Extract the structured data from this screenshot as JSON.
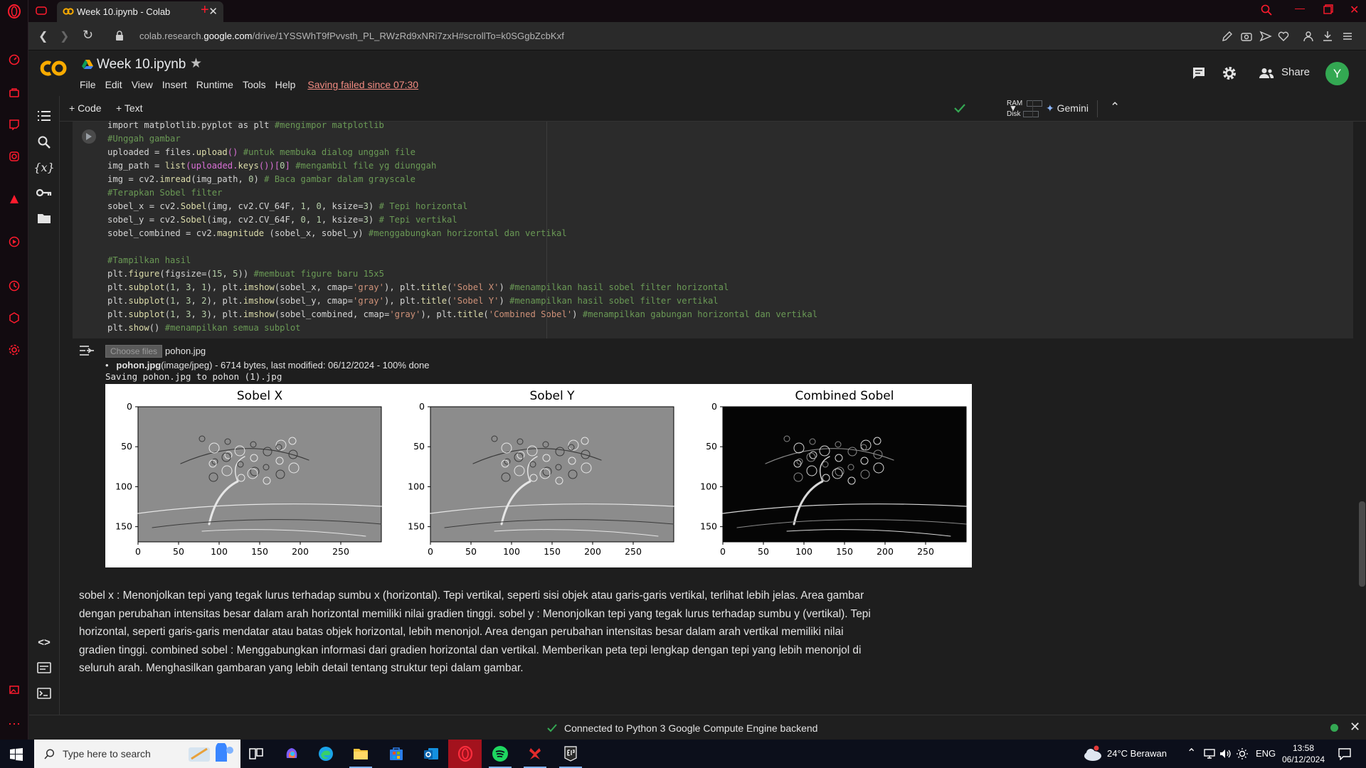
{
  "browser": {
    "tab_title": "Week 10.ipynb - Colab",
    "url_prefix": "colab.research.",
    "url_domain": "google.com",
    "url_path": "/drive/1YSSWhT9fPvvsth_PL_RWzRd9xNRi7zxH#scrollTo=k0SGgbZcbKxf"
  },
  "colab": {
    "notebook_title": "Week 10.ipynb",
    "menu": [
      "File",
      "Edit",
      "View",
      "Insert",
      "Runtime",
      "Tools",
      "Help"
    ],
    "saving_status": "Saving failed since 07:30",
    "share_label": "Share",
    "avatar_letter": "Y",
    "add_code": "+ Code",
    "add_text": "+ Text",
    "ram_label": "RAM",
    "disk_label": "Disk",
    "gemini_label": "Gemini"
  },
  "code_lines": [
    [
      [
        "import matplotlib.pyplot as plt ",
        ""
      ],
      [
        "#mengimpor matplotlib",
        "cm"
      ]
    ],
    [
      [
        "#Unggah gambar",
        "cm"
      ]
    ],
    [
      [
        "uploaded = files.",
        ""
      ],
      [
        "upload",
        "fn"
      ],
      [
        "() ",
        "br"
      ],
      [
        "#untuk membuka dialog unggah file",
        "cm"
      ]
    ],
    [
      [
        "img_path = ",
        ""
      ],
      [
        "list",
        "fn"
      ],
      [
        "(uploaded.",
        "br"
      ],
      [
        "keys",
        "fn"
      ],
      [
        "())[",
        "br"
      ],
      [
        "0",
        "nm"
      ],
      [
        "] ",
        "br"
      ],
      [
        "#mengambil file yg diunggah",
        "cm"
      ]
    ],
    [
      [
        "img = cv2.",
        ""
      ],
      [
        "imread",
        "fn"
      ],
      [
        "(img_path, ",
        ""
      ],
      [
        "0",
        "nm"
      ],
      [
        ") ",
        ""
      ],
      [
        "# Baca gambar dalam grayscale",
        "cm"
      ]
    ],
    [
      [
        "#Terapkan Sobel filter",
        "cm"
      ]
    ],
    [
      [
        "sobel_x = cv2.",
        ""
      ],
      [
        "Sobel",
        "fn"
      ],
      [
        "(img, cv2.CV_64F, ",
        ""
      ],
      [
        "1",
        "nm"
      ],
      [
        ", ",
        ""
      ],
      [
        "0",
        "nm"
      ],
      [
        ", ksize=",
        ""
      ],
      [
        "3",
        "nm"
      ],
      [
        ") ",
        ""
      ],
      [
        "# Tepi horizontal",
        "cm"
      ]
    ],
    [
      [
        "sobel_y = cv2.",
        ""
      ],
      [
        "Sobel",
        "fn"
      ],
      [
        "(img, cv2.CV_64F, ",
        ""
      ],
      [
        "0",
        "nm"
      ],
      [
        ", ",
        ""
      ],
      [
        "1",
        "nm"
      ],
      [
        ", ksize=",
        ""
      ],
      [
        "3",
        "nm"
      ],
      [
        ") ",
        ""
      ],
      [
        "# Tepi vertikal",
        "cm"
      ]
    ],
    [
      [
        "sobel_combined = cv2.",
        ""
      ],
      [
        "magnitude",
        "fn"
      ],
      [
        " (sobel_x, sobel_y) ",
        ""
      ],
      [
        "#menggabungkan horizontal dan vertikal",
        "cm"
      ]
    ],
    [
      [
        "",
        ""
      ]
    ],
    [
      [
        "#Tampilkan hasil",
        "cm"
      ]
    ],
    [
      [
        "plt.",
        ""
      ],
      [
        "figure",
        "fn"
      ],
      [
        "(figsize=(",
        ""
      ],
      [
        "15",
        "nm"
      ],
      [
        ", ",
        ""
      ],
      [
        "5",
        "nm"
      ],
      [
        ")) ",
        ""
      ],
      [
        "#membuat figure baru 15x5",
        "cm"
      ]
    ],
    [
      [
        "plt.",
        ""
      ],
      [
        "subplot",
        "fn"
      ],
      [
        "(",
        ""
      ],
      [
        "1",
        "nm"
      ],
      [
        ", ",
        ""
      ],
      [
        "3",
        "nm"
      ],
      [
        ", ",
        ""
      ],
      [
        "1",
        "nm"
      ],
      [
        "), plt.",
        ""
      ],
      [
        "imshow",
        "fn"
      ],
      [
        "(sobel_x, cmap=",
        ""
      ],
      [
        "'gray'",
        "st"
      ],
      [
        "), plt.",
        ""
      ],
      [
        "title",
        "fn"
      ],
      [
        "(",
        ""
      ],
      [
        "'Sobel X'",
        "st"
      ],
      [
        ") ",
        ""
      ],
      [
        "#menampilkan hasil sobel filter horizontal",
        "cm"
      ]
    ],
    [
      [
        "plt.",
        ""
      ],
      [
        "subplot",
        "fn"
      ],
      [
        "(",
        ""
      ],
      [
        "1",
        "nm"
      ],
      [
        ", ",
        ""
      ],
      [
        "3",
        "nm"
      ],
      [
        ", ",
        ""
      ],
      [
        "2",
        "nm"
      ],
      [
        "), plt.",
        ""
      ],
      [
        "imshow",
        "fn"
      ],
      [
        "(sobel_y, cmap=",
        ""
      ],
      [
        "'gray'",
        "st"
      ],
      [
        "), plt.",
        ""
      ],
      [
        "title",
        "fn"
      ],
      [
        "(",
        ""
      ],
      [
        "'Sobel Y'",
        "st"
      ],
      [
        ") ",
        ""
      ],
      [
        "#menampilkan hasil sobel filter vertikal",
        "cm"
      ]
    ],
    [
      [
        "plt.",
        ""
      ],
      [
        "subplot",
        "fn"
      ],
      [
        "(",
        ""
      ],
      [
        "1",
        "nm"
      ],
      [
        ", ",
        ""
      ],
      [
        "3",
        "nm"
      ],
      [
        ", ",
        ""
      ],
      [
        "3",
        "nm"
      ],
      [
        "), plt.",
        ""
      ],
      [
        "imshow",
        "fn"
      ],
      [
        "(sobel_combined, cmap=",
        ""
      ],
      [
        "'gray'",
        "st"
      ],
      [
        "), plt.",
        ""
      ],
      [
        "title",
        "fn"
      ],
      [
        "(",
        ""
      ],
      [
        "'Combined Sobel'",
        "st"
      ],
      [
        ") ",
        ""
      ],
      [
        "#menampilkan gabungan horizontal dan vertikal",
        "cm"
      ]
    ],
    [
      [
        "plt.",
        ""
      ],
      [
        "show",
        "fn"
      ],
      [
        "() ",
        ""
      ],
      [
        "#menampilkan semua subplot",
        "cm"
      ]
    ]
  ],
  "output": {
    "choose_files": "Choose files",
    "chosen_file": "pohon.jpg",
    "upload_name": "pohon.jpg",
    "upload_info": "(image/jpeg) - 6714 bytes, last modified: 06/12/2024 - 100% done",
    "saving_line": "Saving pohon.jpg to pohon (1).jpg"
  },
  "plots": [
    {
      "title": "Sobel X",
      "style": "gray"
    },
    {
      "title": "Sobel Y",
      "style": "gray"
    },
    {
      "title": "Combined Sobel",
      "style": "dark"
    }
  ],
  "plot_axes": {
    "xticks": [
      "0",
      "50",
      "100",
      "150",
      "200",
      "250"
    ],
    "yticks": [
      "0",
      "50",
      "100",
      "150"
    ]
  },
  "markdown_text": "sobel x : Menonjolkan tepi yang tegak lurus terhadap sumbu x (horizontal). Tepi vertikal, seperti sisi objek atau garis-garis vertikal, terlihat lebih jelas. Area gambar dengan perubahan intensitas besar dalam arah horizontal memiliki nilai gradien tinggi. sobel y : Menonjolkan tepi yang tegak lurus terhadap sumbu y (vertikal). Tepi horizontal, seperti garis-garis mendatar atau batas objek horizontal, lebih menonjol. Area dengan perubahan intensitas besar dalam arah vertikal memiliki nilai gradien tinggi. combined sobel : Menggabungkan informasi dari gradien horizontal dan vertikal. Memberikan peta tepi lengkap dengan tepi yang lebih menonjol di seluruh arah. Menghasilkan gambaran yang lebih detail tentang struktur tepi dalam gambar.",
  "status": {
    "connection": "Connected to Python 3 Google Compute Engine backend"
  },
  "taskbar": {
    "search_placeholder": "Type here to search",
    "weather": "24°C  Berawan",
    "language": "ENG",
    "time": "13:58",
    "date": "06/12/2024"
  },
  "colors": {
    "opera_red": "#ff1b2d",
    "colab_orange": "#f9ab00",
    "avatar_green": "#33a852",
    "warn_red": "#f28b82"
  }
}
